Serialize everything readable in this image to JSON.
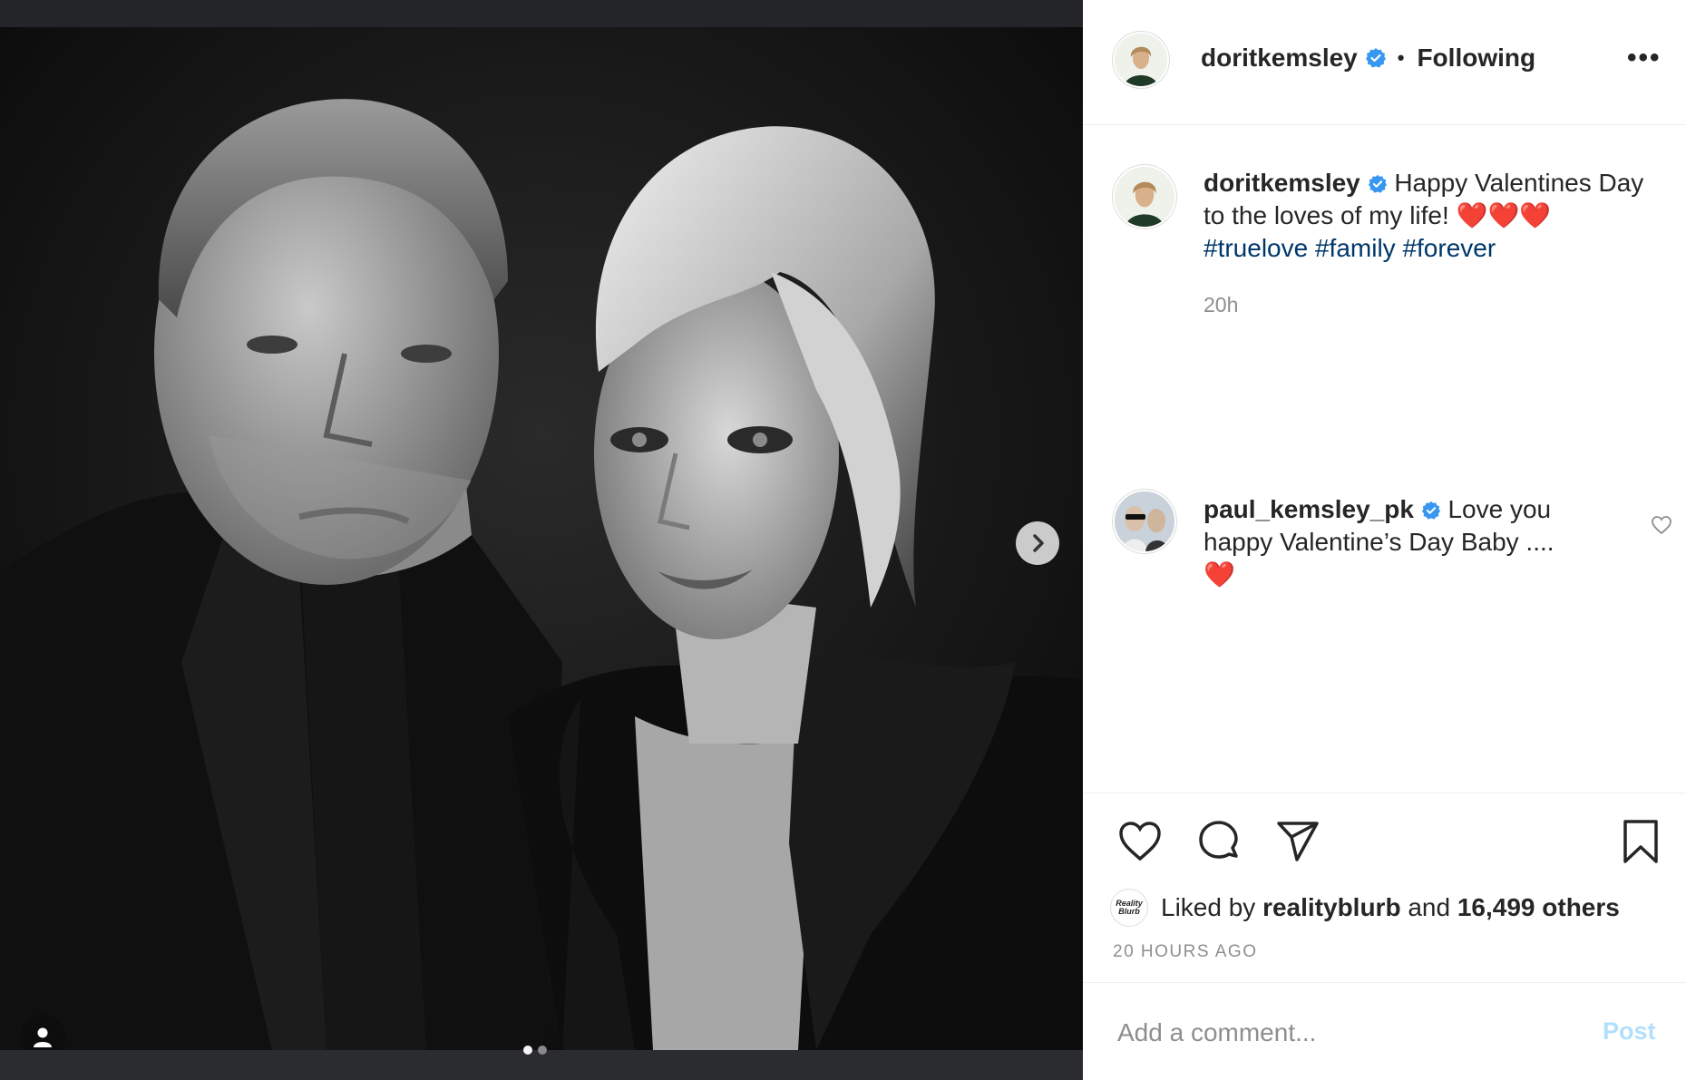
{
  "post": {
    "image_alt": "Black and white portrait of a couple",
    "carousel": {
      "total": 2,
      "current": 1
    }
  },
  "header": {
    "username": "doritkemsley",
    "separator": "•",
    "follow_state": "Following",
    "more_label": "•••"
  },
  "caption": {
    "username": "doritkemsley",
    "text": "Happy Valentines Day to the loves of my life!",
    "emoji": "❤️❤️❤️",
    "hashtags": [
      "#truelove",
      "#family",
      "#forever"
    ],
    "time": "20h"
  },
  "comment": {
    "username": "paul_kemsley_pk",
    "text": "Love you happy Valentine’s Day Baby ....",
    "emoji": "❤️"
  },
  "likes": {
    "prefix": "Liked by",
    "liker": "realityblurb",
    "liker_avatar_text": "Reality Blurb",
    "conj": "and",
    "others": "16,499 others"
  },
  "timestamp": "20 HOURS AGO",
  "add_comment": {
    "placeholder": "Add a comment...",
    "post_label": "Post"
  },
  "colors": {
    "link": "#00376b",
    "verified": "#3897f0",
    "post_disabled": "#b2dffc",
    "muted": "#8e8e8e"
  }
}
